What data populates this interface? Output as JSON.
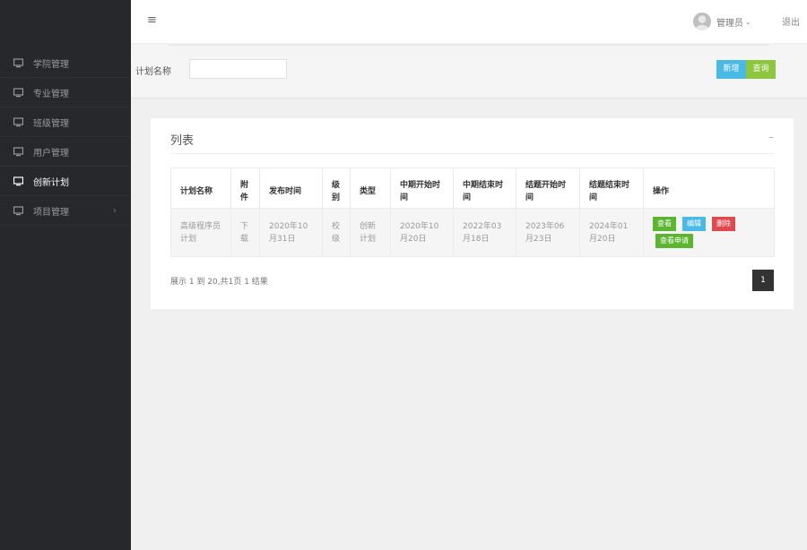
{
  "sidebar": {
    "items": [
      {
        "label": "学院管理",
        "active": false
      },
      {
        "label": "专业管理",
        "active": false
      },
      {
        "label": "班级管理",
        "active": false
      },
      {
        "label": "用户管理",
        "active": false
      },
      {
        "label": "创新计划",
        "active": true
      },
      {
        "label": "项目管理",
        "active": false,
        "has_children": true
      }
    ],
    "chevron": "›"
  },
  "header": {
    "menu_icon": "≡",
    "user_name": "管理员",
    "user_chevron": "⌄",
    "logout": "退出"
  },
  "search": {
    "label": "计划名称",
    "value": "",
    "placeholder": "",
    "add_label": "新增",
    "query_label": "查询"
  },
  "card": {
    "title": "列表",
    "collapse": "–",
    "columns": [
      "计划名称",
      "附件",
      "发布时间",
      "级别",
      "类型",
      "中期开始时间",
      "中期结束时间",
      "结题开始时间",
      "结题结束时间",
      "操作"
    ],
    "rows": [
      {
        "name": "高级程序员计划",
        "attachment": "下载",
        "publish_time": "2020年10月31日",
        "level": "校级",
        "type": "创新计划",
        "mid_start": "2020年10月20日",
        "mid_end": "2022年03月18日",
        "final_start": "2023年06月23日",
        "final_end": "2024年01月20日",
        "ops": {
          "view": "查看",
          "edit": "编辑",
          "delete": "删除",
          "view_apply": "查看申请"
        }
      }
    ],
    "footer_info": "展示 1 到 20,共1页 1 结果",
    "current_page": "1"
  },
  "colors": {
    "sidebar_bg": "#27282b",
    "add_button": "#4bb9e6",
    "query_button": "#8dc63f",
    "view_button": "#5cb531",
    "edit_button": "#4bb9e6",
    "delete_button": "#e0484f",
    "pagination_active": "#333333"
  }
}
